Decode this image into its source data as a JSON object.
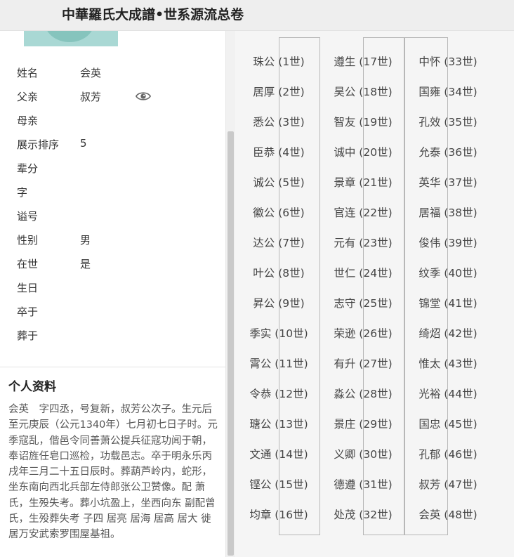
{
  "header": {
    "title": "中華羅氏大成譜•世系源流总卷"
  },
  "profile": {
    "fields": [
      {
        "label": "姓名",
        "value": "会英"
      },
      {
        "label": "父亲",
        "value": "叔芳"
      },
      {
        "label": "母亲",
        "value": ""
      },
      {
        "label": "展示排序",
        "value": "5"
      },
      {
        "label": "辈分",
        "value": ""
      },
      {
        "label": "字",
        "value": ""
      },
      {
        "label": "谥号",
        "value": ""
      },
      {
        "label": "性别",
        "value": "男"
      },
      {
        "label": "在世",
        "value": "是"
      },
      {
        "label": "生日",
        "value": ""
      },
      {
        "label": "卒于",
        "value": ""
      },
      {
        "label": "葬于",
        "value": ""
      }
    ],
    "father_view_icon": "eye-icon"
  },
  "bio": {
    "title": "个人资料",
    "text": "会英　字四丞，号复新，叔芳公次子。生元后至元庚辰（公元1340年）七月初七日子时。元季寇乱，偕邑令同善萧公提兵征寇功闻于朝，奉诏旌任皂口巡检，功载邑志。卒于明永乐丙戌年三月二十五日辰时。葬葫芦岭内，蛇形，坐东南向西北兵部左侍郎张公卫赞像。配 萧氏，生殁失考。葬小坑盈上，坐西向东  副配曾氏，生殁葬失考  子四  居亮  居海  居高  居大  徙居万安武索罗围屋基祖。"
  },
  "lineage": [
    [
      "珠公 (1世)",
      "居厚 (2世)",
      "悉公 (3世)",
      "臣恭 (4世)",
      "诚公 (5世)",
      "徽公 (6世)",
      "达公 (7世)",
      "叶公 (8世)",
      "昇公 (9世)",
      "季实 (10世)",
      "霄公 (11世)",
      "令恭 (12世)",
      "瑭公 (13世)",
      "文通 (14世)",
      "铿公 (15世)",
      "均章 (16世)"
    ],
    [
      "遵生 (17世)",
      "昊公 (18世)",
      "智友 (19世)",
      "诚中 (20世)",
      "景章 (21世)",
      "官连 (22世)",
      "元有 (23世)",
      "世仁 (24世)",
      "志守 (25世)",
      "荣逊 (26世)",
      "有升 (27世)",
      "淼公 (28世)",
      "景庄 (29世)",
      "义卿 (30世)",
      "德遵 (31世)",
      "处茂 (32世)"
    ],
    [
      "中怀 (33世)",
      "国雍 (34世)",
      "孔效 (35世)",
      "允泰 (36世)",
      "英华 (37世)",
      "居福 (38世)",
      "俊伟 (39世)",
      "纹季 (40世)",
      "锦堂 (41世)",
      "绮炤 (42世)",
      "惟太 (43世)",
      "光裕 (44世)",
      "国忠 (45世)",
      "孔郁 (46世)",
      "叔芳 (47世)",
      "会英 (48世)"
    ]
  ]
}
